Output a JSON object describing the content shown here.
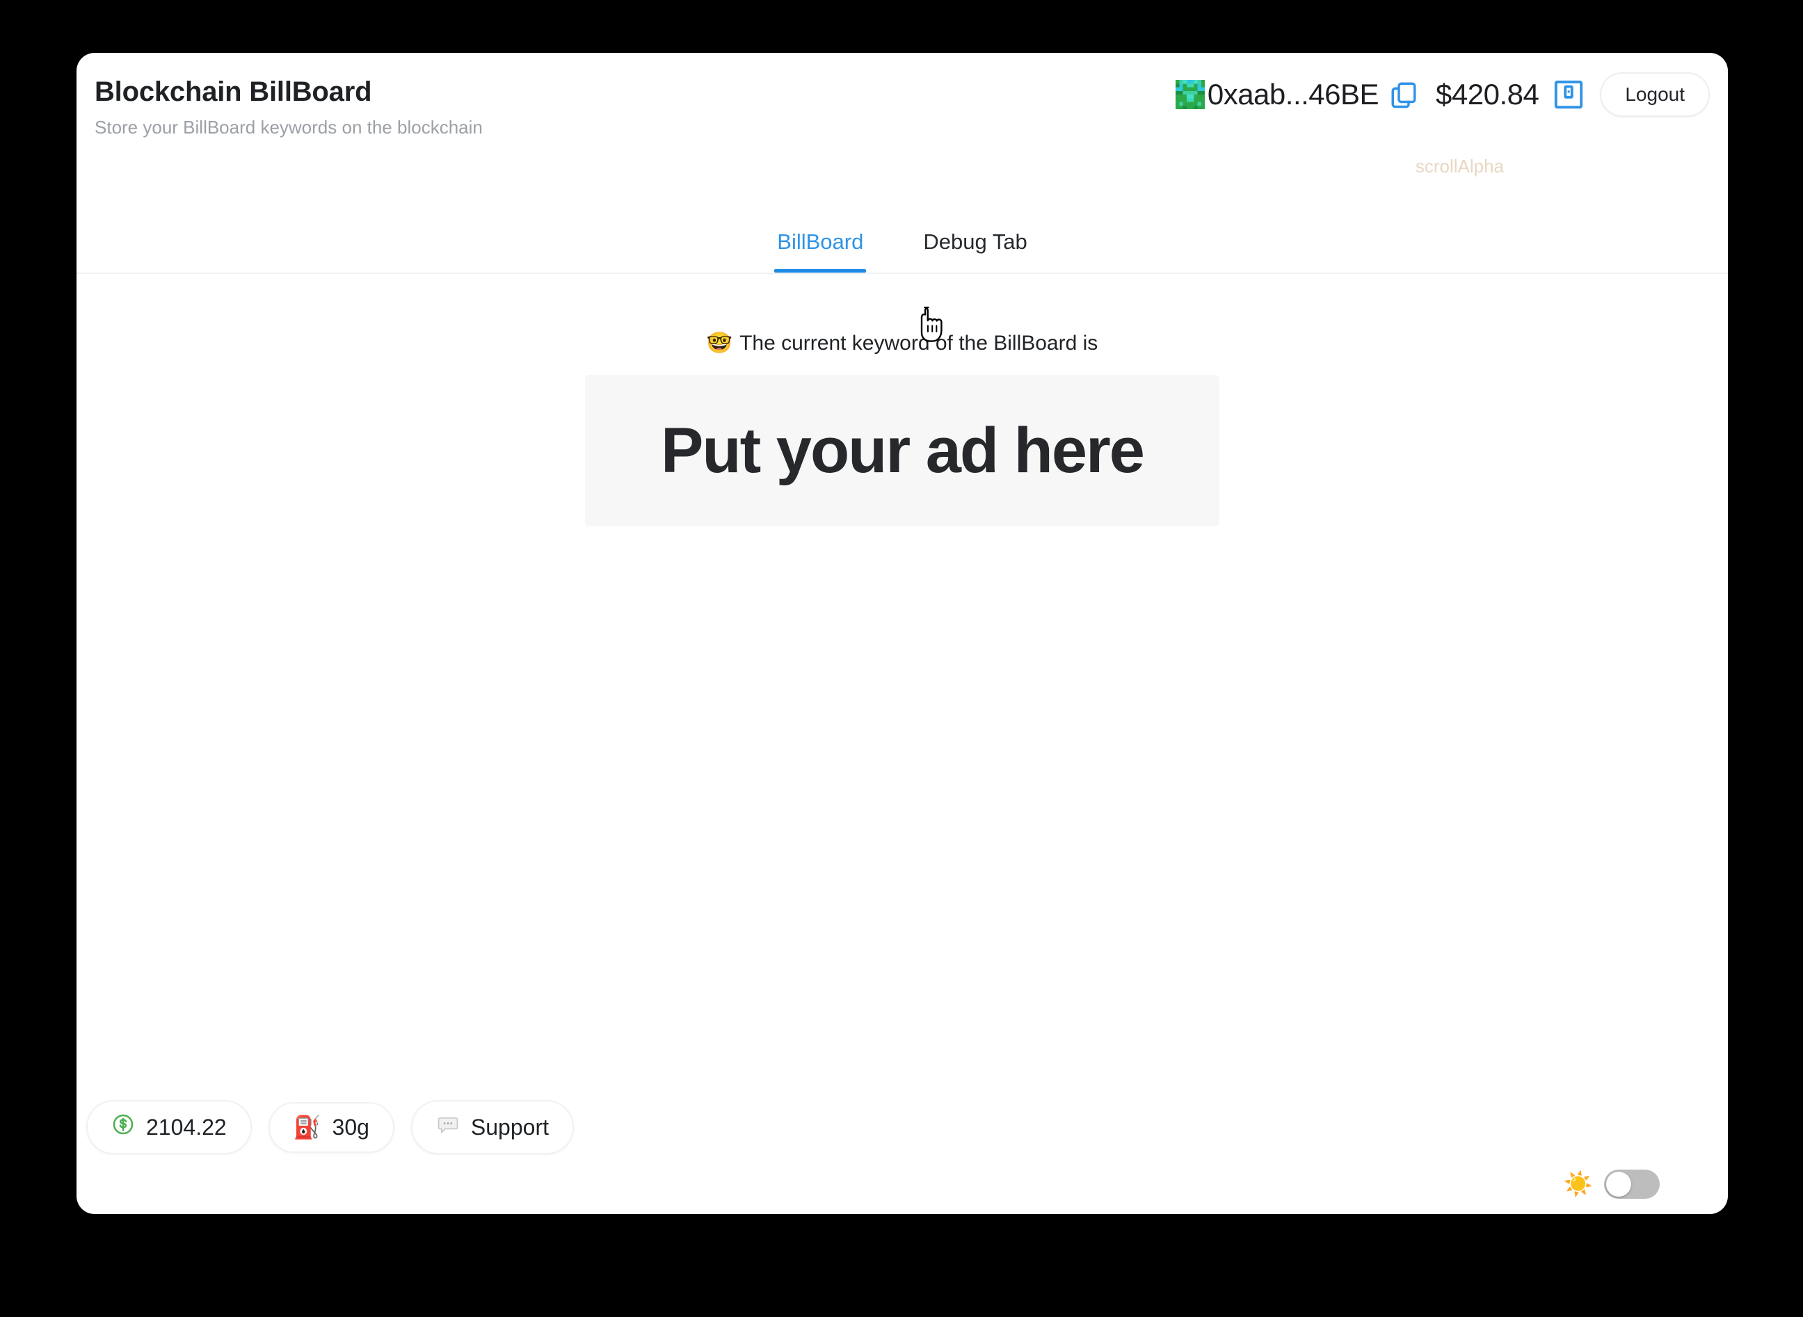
{
  "header": {
    "title": "Blockchain BillBoard",
    "subtitle": "Store your BillBoard keywords on the blockchain",
    "wallet": {
      "address": "0xaab...46BE",
      "balance": "$420.84",
      "network": "scrollAlpha",
      "network_color": "#e8d7c3",
      "copy_icon": "copy-icon",
      "qr_icon": "qr-code-icon",
      "avatar_icon": "blockie-avatar"
    },
    "logout_label": "Logout"
  },
  "tabs": [
    {
      "label": "BillBoard",
      "active": true
    },
    {
      "label": "Debug Tab",
      "active": false
    }
  ],
  "main": {
    "caption_emoji": "🤓",
    "caption_text": "The current keyword of the BillBoard is",
    "billboard_keyword": "Put your ad here"
  },
  "footer": {
    "pills": [
      {
        "icon": "dollar-circle-icon",
        "emoji": "💲",
        "label": "2104.22"
      },
      {
        "icon": "gas-pump-icon",
        "emoji": "⛽",
        "label": "30g"
      },
      {
        "icon": "speech-bubble-icon",
        "emoji": "💬",
        "label": "Support"
      }
    ],
    "theme": {
      "sun_emoji": "☀️",
      "toggle_state": "off"
    }
  },
  "colors": {
    "accent_blue": "#1e8ae6",
    "page_background": "#000000",
    "card_background": "#ffffff",
    "panel_background": "#f7f7f8"
  }
}
